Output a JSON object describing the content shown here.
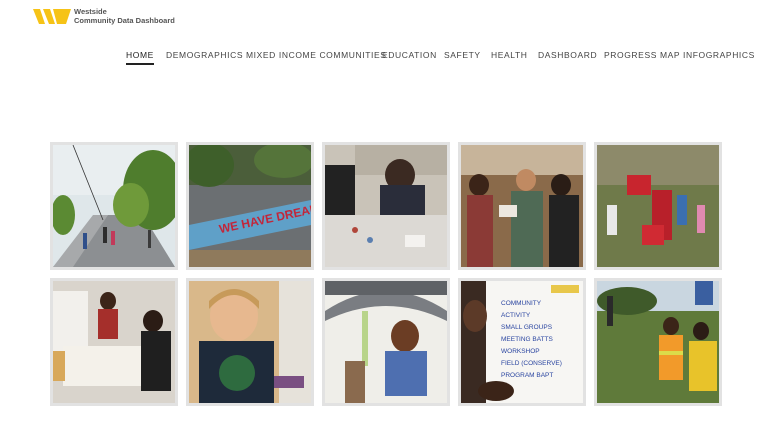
{
  "brand": {
    "logo_icon": "logo-mark-icon",
    "line1": "Westside",
    "line2": "Community Data Dashboard",
    "accent": "#f6c317"
  },
  "nav": {
    "items": [
      {
        "label": "HOME",
        "active": true
      },
      {
        "label": "DEMOGRAPHICS"
      },
      {
        "label": "MIXED INCOME COMMUNITIES"
      },
      {
        "label": "EDUCATION"
      },
      {
        "label": "SAFETY"
      },
      {
        "label": "HEALTH"
      },
      {
        "label": "DASHBOARD"
      },
      {
        "label": "PROGRESS MAP"
      },
      {
        "label": "INFOGRAPHICS"
      }
    ]
  },
  "gallery": {
    "tiles": [
      {
        "subject": "street with trees and pedestrians"
      },
      {
        "subject": "painted mural wall",
        "mural_text": "WE HAVE DREAMS"
      },
      {
        "subject": "people crafting at a table"
      },
      {
        "subject": "community meeting in a room"
      },
      {
        "subject": "children playing with red blocks outdoors"
      },
      {
        "subject": "adults working at a table with paper"
      },
      {
        "subject": "smiling child in green shirt"
      },
      {
        "subject": "child under a foil umbrella"
      },
      {
        "subject": "hand writing on a flip chart"
      },
      {
        "subject": "volunteers in safety vests outdoors"
      }
    ],
    "flipchart_lines": [
      "COMMUNITY",
      "ACTIVITY",
      "SMALL GROUPS",
      "MEETING BATTS",
      "WORKSHOP",
      "FIELD (CONSERVE)",
      "PROGRAM BAPT"
    ]
  }
}
